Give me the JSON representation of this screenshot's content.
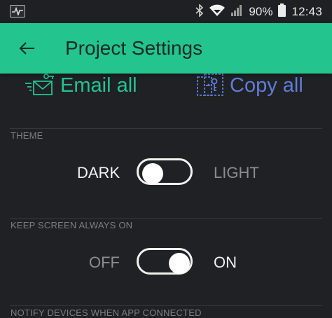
{
  "status_bar": {
    "battery_percent": "90%",
    "time": "12:43",
    "icons": [
      "activity-icon",
      "bluetooth-icon",
      "wifi-icon",
      "signal-icon",
      "battery-icon"
    ]
  },
  "app_bar": {
    "back_icon": "arrow-left-icon",
    "title": "Project Settings",
    "color": "#23c48e"
  },
  "share": {
    "email_label": "Email all",
    "email_icon": "email-key-icon",
    "email_color": "#23c48e",
    "copy_label": "Copy all",
    "copy_icon": "clipboard-key-icon",
    "copy_color": "#5f7cd8"
  },
  "theme": {
    "section_label": "THEME",
    "left_option": "DARK",
    "right_option": "LIGHT",
    "selected": "DARK"
  },
  "keep_screen_on": {
    "section_label": "KEEP SCREEN ALWAYS ON",
    "left_option": "OFF",
    "right_option": "ON",
    "selected": "ON"
  },
  "notify": {
    "section_label": "NOTIFY DEVICES WHEN APP CONNECTED"
  }
}
